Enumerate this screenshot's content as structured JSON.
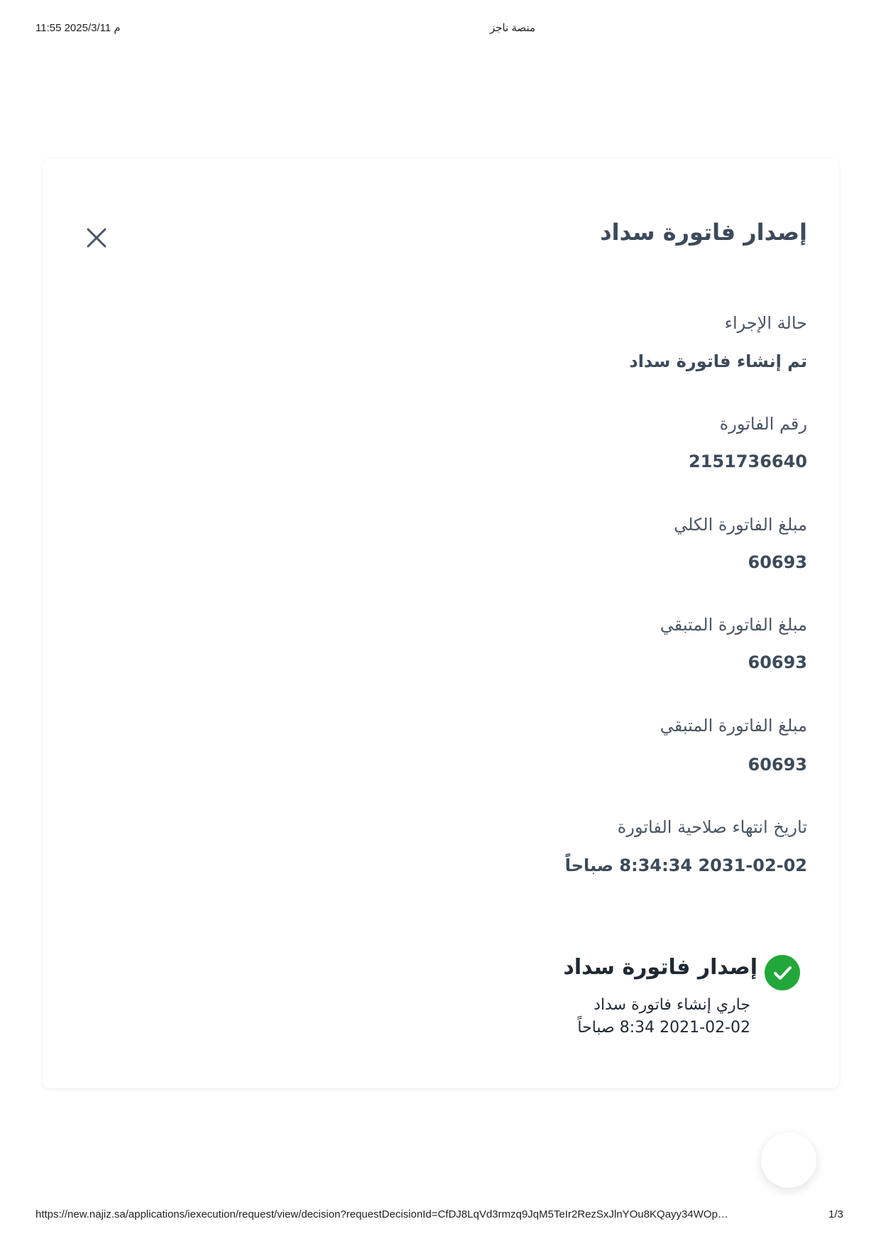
{
  "print_header": {
    "datetime": "11:55 2025/3/11 م",
    "site_title": "منصة ناجز"
  },
  "dialog": {
    "title": "إصدار فاتورة سداد",
    "fields": [
      {
        "label": "حالة الإجراء",
        "value": "تم إنشاء فاتورة سداد"
      },
      {
        "label": "رقم الفاتورة",
        "value": "2151736640"
      },
      {
        "label": "مبلغ الفاتورة الكلي",
        "value": "60693"
      },
      {
        "label": "مبلغ الفاتورة المتبقي",
        "value": "60693"
      },
      {
        "label": "مبلغ الفاتورة المتبقي",
        "value": "60693"
      },
      {
        "label": "تاريخ انتهاء صلاحية الفاتورة",
        "value": "2031-02-02 8:34:34 صباحاً"
      }
    ],
    "timeline": {
      "title": "إصدار فاتورة سداد",
      "status": "جاري إنشاء فاتورة سداد",
      "timestamp": "2021-02-02 8:34 صباحاً",
      "icon": "check-circle-icon",
      "icon_color": "#22a83a"
    }
  },
  "print_footer": {
    "url": "https://new.najiz.sa/applications/iexecution/request/view/decision?requestDecisionId=CfDJ8LqVd3rmzq9JqM5TeIr2RezSxJlnYOu8KQayy34WOp…",
    "page": "1/3"
  }
}
